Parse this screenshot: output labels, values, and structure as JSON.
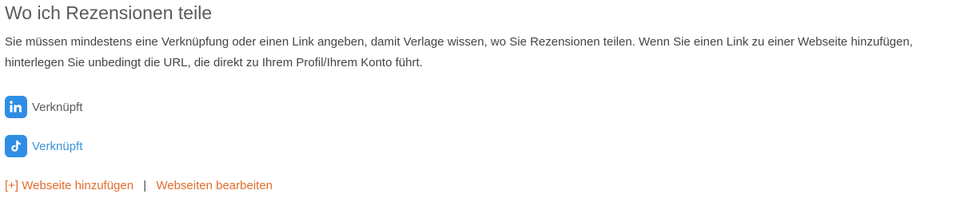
{
  "section": {
    "title": "Wo ich Rezensionen teile",
    "description": "Sie müssen mindestens eine Verknüpfung oder einen Link angeben, damit Verlage wissen, wo Sie Rezensionen teilen. Wenn Sie einen Link zu einer Webseite hinzufügen, hinterlegen Sie unbedingt die URL, die direkt zu Ihrem Profil/Ihrem Konto führt."
  },
  "social": [
    {
      "icon": "linkedin-icon",
      "label": "Verknüpft",
      "color": "#2f8de4"
    },
    {
      "icon": "tiktok-icon",
      "label": "Verknüpft",
      "color": "#2f8de4"
    }
  ],
  "actions": {
    "add_website": "[+] Webseite hinzufügen",
    "separator": "|",
    "edit_websites": "Webseiten bearbeiten"
  },
  "colors": {
    "accent": "#e16d2f",
    "link": "#3b95d8",
    "icon_bg": "#2f8de4"
  }
}
